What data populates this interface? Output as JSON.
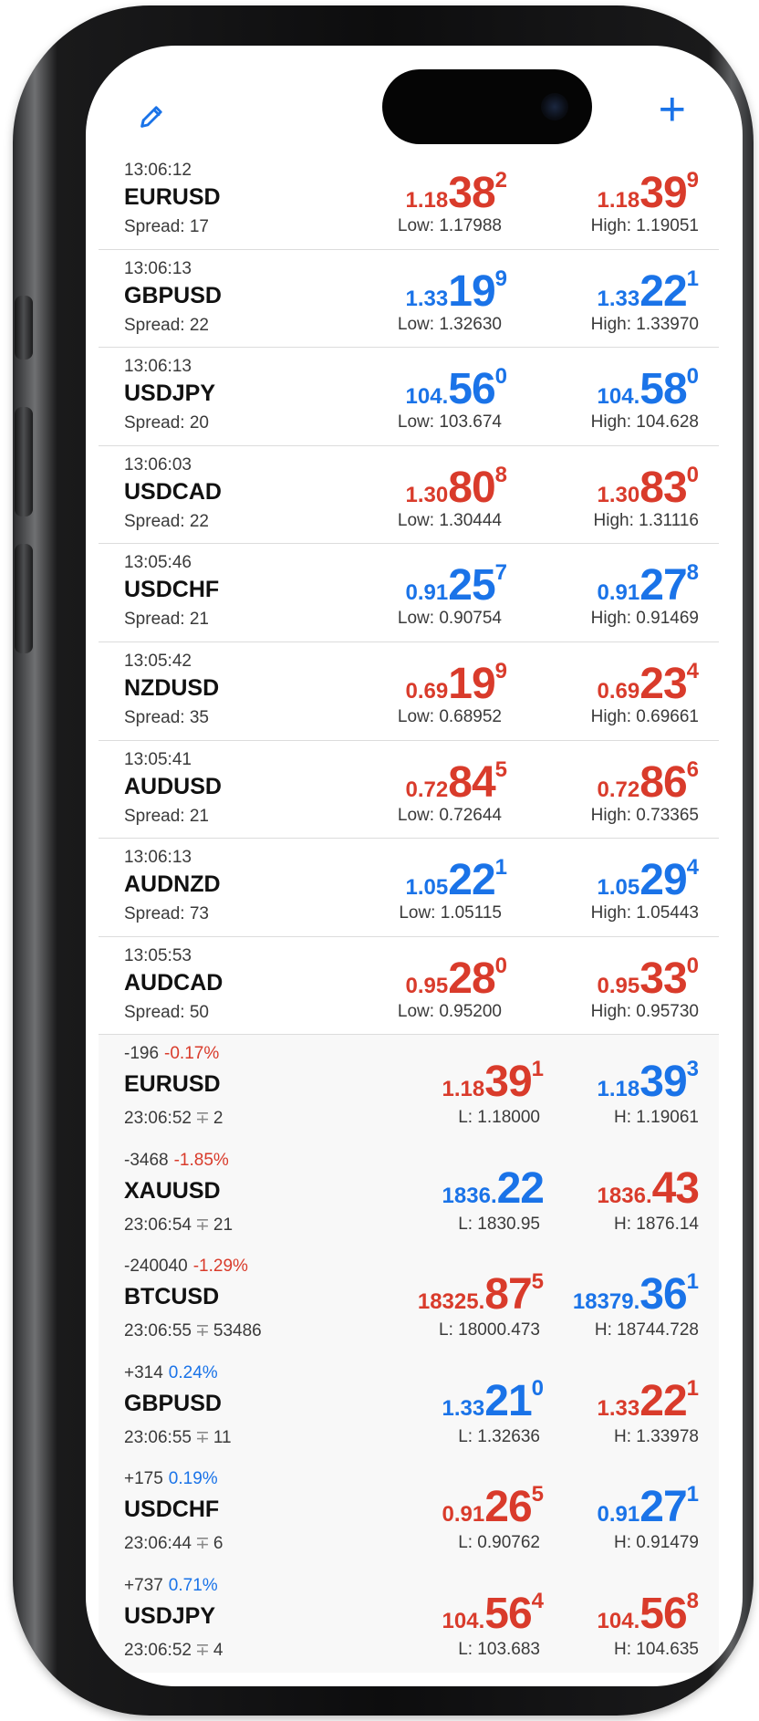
{
  "toolbar": {
    "edit_icon": "pencil-icon",
    "add_label": "+"
  },
  "colors": {
    "up": "#1a73e8",
    "down": "#d93b2b"
  },
  "quotes": [
    {
      "time": "13:06:12",
      "symbol": "EURUSD",
      "spread": "Spread: 17",
      "bid": {
        "sm": "1.18",
        "big": "38",
        "sup": "2",
        "color": "red"
      },
      "ask": {
        "sm": "1.18",
        "big": "39",
        "sup": "9",
        "color": "red"
      },
      "low": "Low: 1.17988",
      "high": "High: 1.19051"
    },
    {
      "time": "13:06:13",
      "symbol": "GBPUSD",
      "spread": "Spread: 22",
      "bid": {
        "sm": "1.33",
        "big": "19",
        "sup": "9",
        "color": "blue"
      },
      "ask": {
        "sm": "1.33",
        "big": "22",
        "sup": "1",
        "color": "blue"
      },
      "low": "Low: 1.32630",
      "high": "High: 1.33970"
    },
    {
      "time": "13:06:13",
      "symbol": "USDJPY",
      "spread": "Spread: 20",
      "bid": {
        "sm": "104.",
        "big": "56",
        "sup": "0",
        "color": "blue"
      },
      "ask": {
        "sm": "104.",
        "big": "58",
        "sup": "0",
        "color": "blue"
      },
      "low": "Low: 103.674",
      "high": "High: 104.628"
    },
    {
      "time": "13:06:03",
      "symbol": "USDCAD",
      "spread": "Spread: 22",
      "bid": {
        "sm": "1.30",
        "big": "80",
        "sup": "8",
        "color": "red"
      },
      "ask": {
        "sm": "1.30",
        "big": "83",
        "sup": "0",
        "color": "red"
      },
      "low": "Low: 1.30444",
      "high": "High: 1.31116"
    },
    {
      "time": "13:05:46",
      "symbol": "USDCHF",
      "spread": "Spread: 21",
      "bid": {
        "sm": "0.91",
        "big": "25",
        "sup": "7",
        "color": "blue"
      },
      "ask": {
        "sm": "0.91",
        "big": "27",
        "sup": "8",
        "color": "blue"
      },
      "low": "Low: 0.90754",
      "high": "High: 0.91469"
    },
    {
      "time": "13:05:42",
      "symbol": "NZDUSD",
      "spread": "Spread: 35",
      "bid": {
        "sm": "0.69",
        "big": "19",
        "sup": "9",
        "color": "red"
      },
      "ask": {
        "sm": "0.69",
        "big": "23",
        "sup": "4",
        "color": "red"
      },
      "low": "Low: 0.68952",
      "high": "High: 0.69661"
    },
    {
      "time": "13:05:41",
      "symbol": "AUDUSD",
      "spread": "Spread: 21",
      "bid": {
        "sm": "0.72",
        "big": "84",
        "sup": "5",
        "color": "red"
      },
      "ask": {
        "sm": "0.72",
        "big": "86",
        "sup": "6",
        "color": "red"
      },
      "low": "Low: 0.72644",
      "high": "High: 0.73365"
    },
    {
      "time": "13:06:13",
      "symbol": "AUDNZD",
      "spread": "Spread: 73",
      "bid": {
        "sm": "1.05",
        "big": "22",
        "sup": "1",
        "color": "blue"
      },
      "ask": {
        "sm": "1.05",
        "big": "29",
        "sup": "4",
        "color": "blue"
      },
      "low": "Low: 1.05115",
      "high": "High: 1.05443"
    },
    {
      "time": "13:05:53",
      "symbol": "AUDCAD",
      "spread": "Spread: 50",
      "bid": {
        "sm": "0.95",
        "big": "28",
        "sup": "0",
        "color": "red"
      },
      "ask": {
        "sm": "0.95",
        "big": "33",
        "sup": "0",
        "color": "red"
      },
      "low": "Low: 0.95200",
      "high": "High: 0.95730"
    }
  ],
  "positions": [
    {
      "change": "-196",
      "pct": "-0.17%",
      "pct_color": "red",
      "symbol": "EURUSD",
      "time": "23:06:52",
      "count": "2",
      "bid": {
        "sm": "1.18",
        "big": "39",
        "sup": "1",
        "color": "red"
      },
      "ask": {
        "sm": "1.18",
        "big": "39",
        "sup": "3",
        "color": "blue"
      },
      "low": "L: 1.18000",
      "high": "H: 1.19061"
    },
    {
      "change": "-3468",
      "pct": "-1.85%",
      "pct_color": "red",
      "symbol": "XAUUSD",
      "time": "23:06:54",
      "count": "21",
      "bid": {
        "sm": "1836.",
        "big": "22",
        "sup": "",
        "color": "blue"
      },
      "ask": {
        "sm": "1836.",
        "big": "43",
        "sup": "",
        "color": "red"
      },
      "low": "L: 1830.95",
      "high": "H: 1876.14"
    },
    {
      "change": "-240040",
      "pct": "-1.29%",
      "pct_color": "red",
      "symbol": "BTCUSD",
      "time": "23:06:55",
      "count": "53486",
      "bid": {
        "sm": "18325.",
        "big": "87",
        "sup": "5",
        "color": "red"
      },
      "ask": {
        "sm": "18379.",
        "big": "36",
        "sup": "1",
        "color": "blue"
      },
      "low": "L: 18000.473",
      "high": "H: 18744.728"
    },
    {
      "change": "+314",
      "pct": "0.24%",
      "pct_color": "blue",
      "symbol": "GBPUSD",
      "time": "23:06:55",
      "count": "11",
      "bid": {
        "sm": "1.33",
        "big": "21",
        "sup": "0",
        "color": "blue"
      },
      "ask": {
        "sm": "1.33",
        "big": "22",
        "sup": "1",
        "color": "red"
      },
      "low": "L: 1.32636",
      "high": "H: 1.33978"
    },
    {
      "change": "+175",
      "pct": "0.19%",
      "pct_color": "blue",
      "symbol": "USDCHF",
      "time": "23:06:44",
      "count": "6",
      "bid": {
        "sm": "0.91",
        "big": "26",
        "sup": "5",
        "color": "red"
      },
      "ask": {
        "sm": "0.91",
        "big": "27",
        "sup": "1",
        "color": "blue"
      },
      "low": "L: 0.90762",
      "high": "H: 0.91479"
    },
    {
      "change": "+737",
      "pct": "0.71%",
      "pct_color": "blue",
      "symbol": "USDJPY",
      "time": "23:06:52",
      "count": "4",
      "bid": {
        "sm": "104.",
        "big": "56",
        "sup": "4",
        "color": "red"
      },
      "ask": {
        "sm": "104.",
        "big": "56",
        "sup": "8",
        "color": "red"
      },
      "low": "L: 103.683",
      "high": "H: 104.635"
    }
  ]
}
